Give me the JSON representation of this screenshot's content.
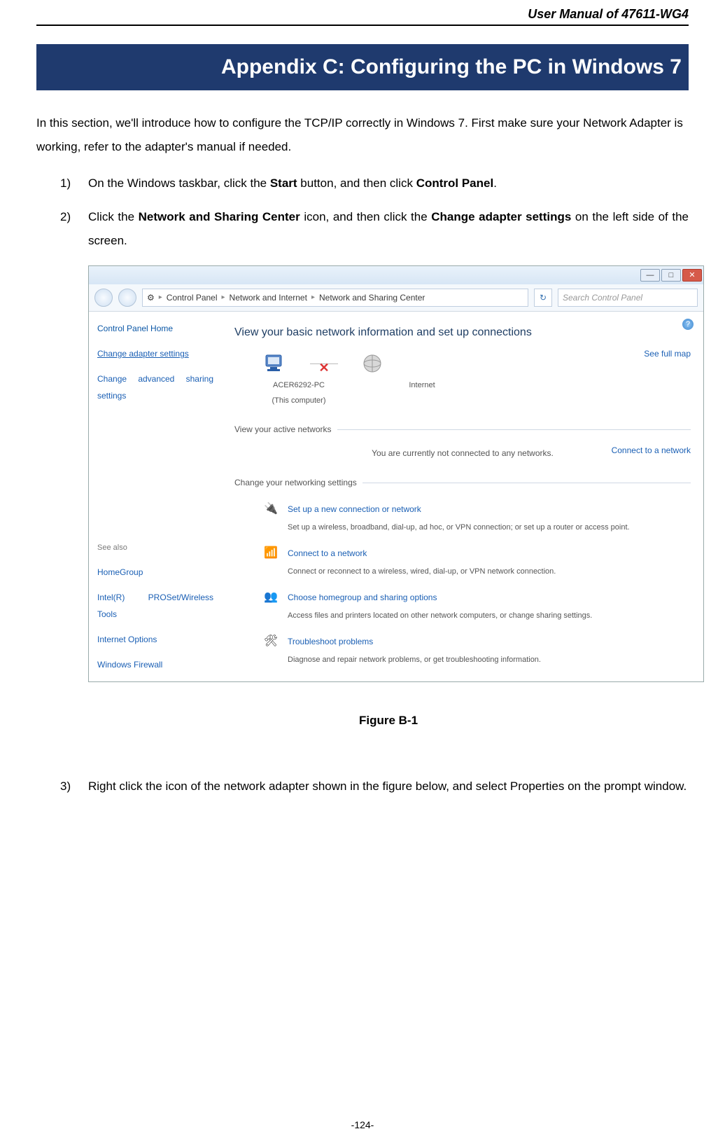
{
  "header": {
    "doc_title": "User Manual of 47611-WG4"
  },
  "appendix": {
    "title": "Appendix C: Configuring the PC in Windows 7"
  },
  "intro": "In this section, we'll introduce how to configure the TCP/IP correctly in Windows 7. First make sure your Network Adapter is working, refer to the adapter's manual if needed.",
  "steps": {
    "s1": {
      "num": "1)",
      "pre": "On the Windows taskbar, click the ",
      "b1": "Start",
      "mid": " button, and then click ",
      "b2": "Control Panel",
      "post": "."
    },
    "s2": {
      "num": "2)",
      "pre": "Click the ",
      "b1": "Network and Sharing Center",
      "mid": " icon, and then click the ",
      "b2": "Change adapter settings",
      "post": " on the left side of the screen."
    },
    "s3": {
      "num": "3)",
      "text": "Right click the icon of the network adapter shown in the figure below, and select Properties on the prompt window."
    }
  },
  "figure": {
    "caption": "Figure B-1"
  },
  "win7": {
    "titlebar": {
      "min": "—",
      "max": "□",
      "close": "✕"
    },
    "addr": {
      "crumb_icon": "⚙",
      "crumbs": [
        "Control Panel",
        "Network and Internet",
        "Network and Sharing Center"
      ],
      "sep": "▸",
      "refresh": "↻",
      "search_placeholder": "Search Control Panel"
    },
    "side": {
      "home": "Control Panel Home",
      "link1": "Change adapter settings",
      "link2": "Change advanced sharing settings",
      "footer_heading": "See also",
      "footer_items": [
        "HomeGroup",
        "Intel(R) PROSet/Wireless Tools",
        "Internet Options",
        "Windows Firewall"
      ]
    },
    "main": {
      "help": "?",
      "title": "View your basic network information and set up connections",
      "see_full": "See full map",
      "connect": "Connect to a network",
      "pc_name": "ACER6292-PC",
      "pc_sub": "(This computer)",
      "internet": "Internet",
      "x": "✕",
      "view_active": "View your active networks",
      "not_connected": "You are currently not connected to any networks.",
      "change_settings": "Change your networking settings",
      "items": [
        {
          "icon": "🔌",
          "link": "Set up a new connection or network",
          "desc": "Set up a wireless, broadband, dial-up, ad hoc, or VPN connection; or set up a router or access point."
        },
        {
          "icon": "📶",
          "link": "Connect to a network",
          "desc": "Connect or reconnect to a wireless, wired, dial-up, or VPN network connection."
        },
        {
          "icon": "👥",
          "link": "Choose homegroup and sharing options",
          "desc": "Access files and printers located on other network computers, or change sharing settings."
        },
        {
          "icon": "🛠",
          "link": "Troubleshoot problems",
          "desc": "Diagnose and repair network problems, or get troubleshooting information."
        }
      ]
    }
  },
  "page_number": "-124-"
}
